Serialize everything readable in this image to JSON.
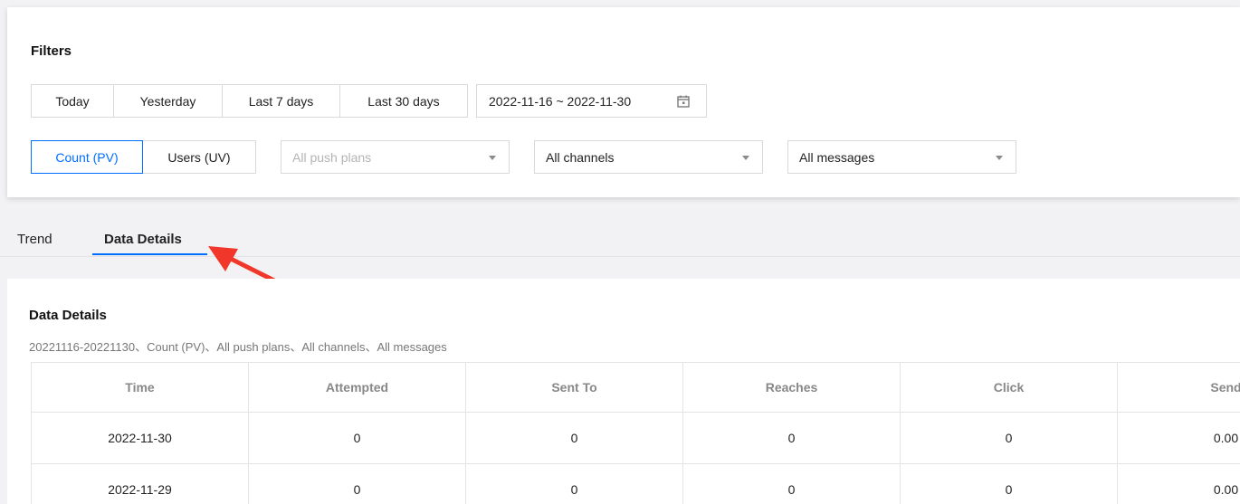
{
  "filters": {
    "title": "Filters",
    "quick_ranges": [
      "Today",
      "Yesterday",
      "Last 7 days",
      "Last 30 days"
    ],
    "date_range": "2022-11-16 ~ 2022-11-30",
    "metric_toggle": {
      "options": [
        "Count (PV)",
        "Users (UV)"
      ],
      "selected": "Count (PV)"
    },
    "push_plan_select": {
      "placeholder": "All push plans",
      "value": ""
    },
    "channel_select": {
      "value": "All channels"
    },
    "message_select": {
      "value": "All messages"
    }
  },
  "tabs": [
    {
      "label": "Trend",
      "active": false
    },
    {
      "label": "Data Details",
      "active": true
    }
  ],
  "annotation": {
    "arrow_color": "#f0372a"
  },
  "details": {
    "title": "Data Details",
    "subtitle": "20221116-20221130、Count (PV)、All push plans、All channels、All messages",
    "columns": [
      "Time",
      "Attempted",
      "Sent To",
      "Reaches",
      "Click",
      "Send"
    ],
    "rows": [
      [
        "2022-11-30",
        "0",
        "0",
        "0",
        "0",
        "0.00"
      ],
      [
        "2022-11-29",
        "0",
        "0",
        "0",
        "0",
        "0.00"
      ]
    ]
  },
  "colors": {
    "accent": "#006eff",
    "background": "#f2f2f4"
  }
}
